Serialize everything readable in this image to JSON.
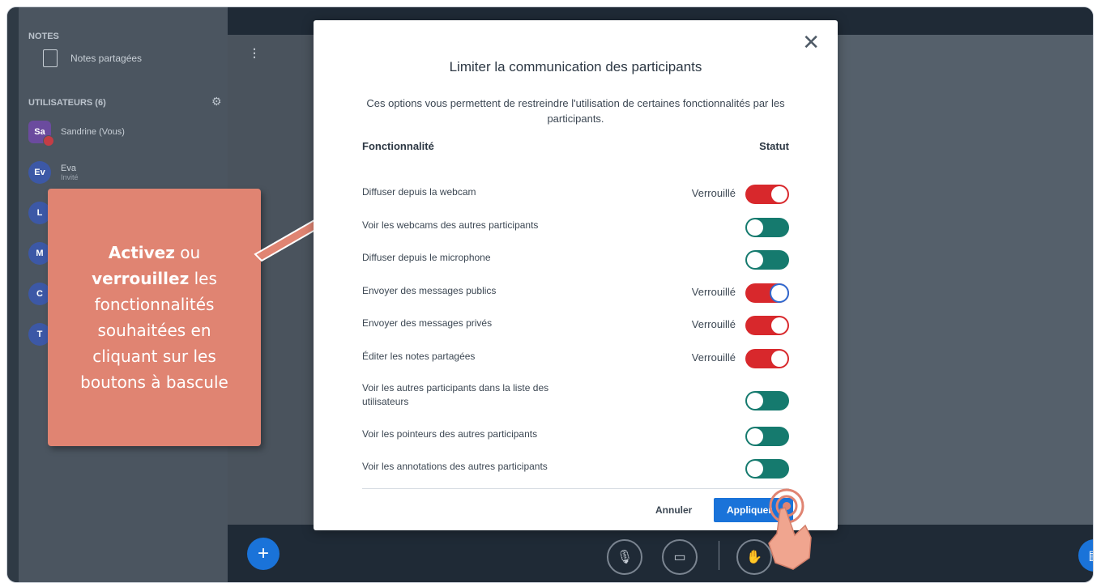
{
  "sidebar": {
    "notes_header": "NOTES",
    "shared_notes_label": "Notes partagées",
    "users_header": "UTILISATEURS (6)",
    "users": [
      {
        "initials": "Sa",
        "name": "Sandrine (Vous)",
        "sub": "",
        "color": "#6b4b9e"
      },
      {
        "initials": "Ev",
        "name": "Eva",
        "sub": "Invité",
        "color": "#3c58a6"
      },
      {
        "initials": "L",
        "name": "",
        "sub": "",
        "color": "#3c58a6"
      },
      {
        "initials": "M",
        "name": "",
        "sub": "",
        "color": "#3c58a6"
      },
      {
        "initials": "C",
        "name": "",
        "sub": "",
        "color": "#3c58a6"
      },
      {
        "initials": "T",
        "name": "",
        "sub": "",
        "color": "#3c58a6"
      }
    ]
  },
  "modal": {
    "title": "Limiter la communication des participants",
    "description": "Ces options vous permettent de restreindre l'utilisation de certaines fonctionnalités par les participants.",
    "col_feature": "Fonctionnalité",
    "col_status": "Statut",
    "rows": [
      {
        "label": "Diffuser depuis la webcam",
        "status": "Verrouillé",
        "locked": true
      },
      {
        "label": "Voir les webcams des autres participants",
        "status": "",
        "locked": false
      },
      {
        "label": "Diffuser depuis le microphone",
        "status": "",
        "locked": false
      },
      {
        "label": "Envoyer des messages publics",
        "status": "Verrouillé",
        "locked": true
      },
      {
        "label": "Envoyer des messages privés",
        "status": "Verrouillé",
        "locked": true
      },
      {
        "label": "Éditer les notes partagées",
        "status": "Verrouillé",
        "locked": true
      },
      {
        "label": "Voir les autres participants dans la liste des utilisateurs",
        "status": "",
        "locked": false
      },
      {
        "label": "Voir les pointeurs des autres participants",
        "status": "",
        "locked": false
      },
      {
        "label": "Voir les annotations des autres participants",
        "status": "",
        "locked": false
      }
    ],
    "cancel_label": "Annuler",
    "apply_label": "Appliquer"
  },
  "callout": {
    "w1": "Activez",
    "w2": " ou ",
    "w3": "verrouillez",
    "w4": " les fonctionnalités souhaitées en cliquant sur les boutons à bascule"
  },
  "colors": {
    "locked": "#d8282c",
    "unlocked": "#157a6e",
    "primary": "#1a73d9",
    "callout": "#e08472"
  }
}
